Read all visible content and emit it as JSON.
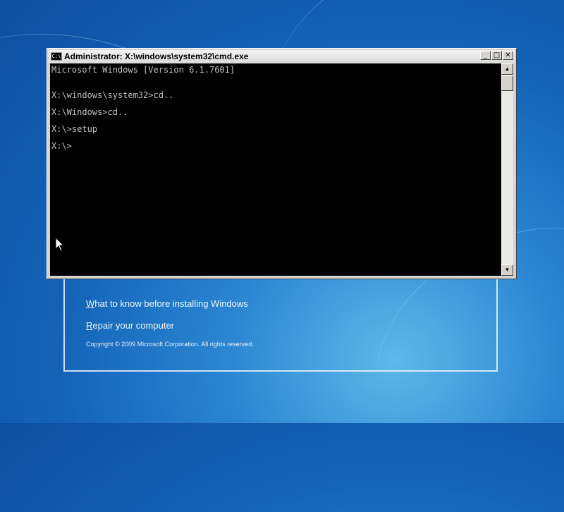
{
  "window": {
    "title": "Administrator: X:\\windows\\system32\\cmd.exe",
    "icon_label": "C:\\",
    "buttons": {
      "minimize": "_",
      "maximize": "□",
      "close": "✕"
    }
  },
  "console": {
    "lines": [
      "Microsoft Windows [Version 6.1.7601]",
      "",
      "X:\\windows\\system32>cd..",
      "",
      "X:\\Windows>cd..",
      "",
      "X:\\>setup",
      "",
      "X:\\>"
    ]
  },
  "scrollbar": {
    "up_arrow": "▲",
    "down_arrow": "▼"
  },
  "setup": {
    "link1_first": "W",
    "link1_rest": "hat to know before installing Windows",
    "link2_first": "R",
    "link2_rest": "epair your computer",
    "copyright": "Copyright © 2009 Microsoft Corporation. All rights reserved."
  }
}
